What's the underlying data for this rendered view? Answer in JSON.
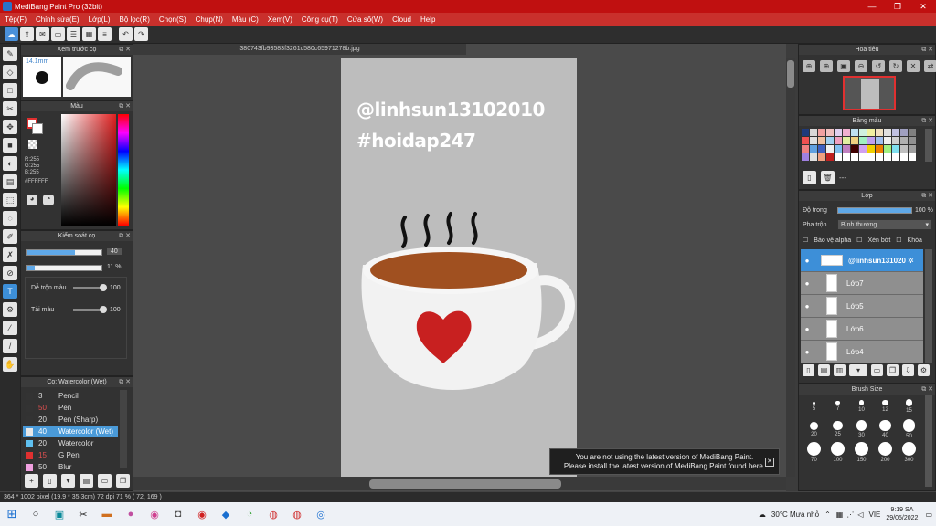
{
  "window": {
    "title": "MediBang Paint Pro (32bit)",
    "min": "—",
    "max": "❐",
    "close": "✕"
  },
  "menu": [
    "Tệp(F)",
    "Chỉnh sửa(E)",
    "Lớp(L)",
    "Bộ lọc(R)",
    "Chọn(S)",
    "Chụp(N)",
    "Màu (C)",
    "Xem(V)",
    "Công cụ(T)",
    "Cửa sổ(W)",
    "Cloud",
    "Help"
  ],
  "document": {
    "tab": "380743fb93583f3261c580c65971278b.jpg"
  },
  "canvas": {
    "caption1": "@linhsun13102010",
    "caption2": "#hoidap247",
    "background": "#bdbdbd"
  },
  "notice": {
    "line1": "You are not using the latest version of MediBang Paint.",
    "line2": "Please install the latest version of MediBang Paint found here."
  },
  "preview": {
    "title": "Xem trước cọ",
    "size": "14.1mm"
  },
  "color": {
    "title": "Màu",
    "r": "R:255",
    "g": "G:255",
    "b": "B:255",
    "hex": "#FFFFFF"
  },
  "brushctl": {
    "title": "Kiểm soát cọ",
    "size_val": "40",
    "opacity_val": "11 %",
    "blend_label": "Dễ trộn màu",
    "blend_val": "100",
    "paint_label": "Tải màu",
    "paint_val": "100",
    "size_fill": 0.65,
    "opacity_fill": 0.11
  },
  "brushlist": {
    "title": "Cọ: Watercolor (Wet)",
    "items": [
      {
        "num": "3",
        "name": "Pencil",
        "color": "#333333",
        "numcolor": "#dddddd"
      },
      {
        "num": "50",
        "name": "Pen",
        "color": "#333333",
        "numcolor": "#e05050"
      },
      {
        "num": "20",
        "name": "Pen (Sharp)",
        "color": "#333333",
        "numcolor": "#dddddd"
      },
      {
        "num": "40",
        "name": "Watercolor (Wet)",
        "color": "#e8e8e8",
        "numcolor": "#e05050",
        "sel": true
      },
      {
        "num": "20",
        "name": "Watercolor",
        "color": "#5fc0f0",
        "numcolor": "#dddddd"
      },
      {
        "num": "15",
        "name": "G Pen",
        "color": "#e03030",
        "numcolor": "#e05050"
      },
      {
        "num": "50",
        "name": "Blur",
        "color": "#f0a0e0",
        "numcolor": "#dddddd"
      }
    ]
  },
  "navigator": {
    "title": "Hoa tiêu"
  },
  "palette": {
    "title": "Bảng màu",
    "dots": "---",
    "colors": [
      "#1f3a7a",
      "#d8d8d8",
      "#f0a0a0",
      "#f0c0c0",
      "#e0d0f0",
      "#f0b0d0",
      "#c0e0f0",
      "#d0f0e0",
      "#f0f0a0",
      "#f0e0c0",
      "#e0e0e0",
      "#c0c0e0",
      "#a0a0c0",
      "#808080",
      "#f05050",
      "#e0e0e0",
      "#f0c0a0",
      "#a0d0f0",
      "#f0a0c0",
      "#e0f0a0",
      "#f0d080",
      "#a0f0c0",
      "#c0a0f0",
      "#a0c0f0",
      "#f0f0f0",
      "#d0d0d0",
      "#b0b0b0",
      "#909090",
      "#f08080",
      "#60a0e0",
      "#4060c0",
      "#f0f0f0",
      "#80c0f0",
      "#c080c0",
      "#400000",
      "#d0a0f0",
      "#f0d000",
      "#f08000",
      "#a0f080",
      "#80e0f0",
      "#c0c0c0",
      "#a0a0a0",
      "#a080e0",
      "#e0e0e0",
      "#f0a080",
      "#c02020",
      "#ffffff",
      "#ffffff",
      "#ffffff",
      "#ffffff",
      "#ffffff",
      "#ffffff",
      "#ffffff",
      "#ffffff",
      "#ffffff",
      "#ffffff"
    ]
  },
  "layers": {
    "title": "Lớp",
    "opacity_label": "Độ trong",
    "opacity_val": "100 %",
    "blend_label": "Pha trộn",
    "blend_val": "Bình thường",
    "protect_alpha": "Bảo vệ alpha",
    "clipping": "Xén bớt",
    "lock": "Khóa",
    "items": [
      {
        "name": "@linhsun131020",
        "sel": true
      },
      {
        "name": "Lớp7"
      },
      {
        "name": "Lớp5"
      },
      {
        "name": "Lớp6"
      },
      {
        "name": "Lớp4"
      }
    ]
  },
  "brushsize": {
    "title": "Brush Size",
    "sizes": [
      "5",
      "7",
      "10",
      "12",
      "15",
      "20",
      "25",
      "30",
      "40",
      "50",
      "70",
      "100",
      "150",
      "200",
      "300"
    ]
  },
  "status": {
    "text": "364 * 1002 pixel   (19.9 * 35.3cm)   72 dpi   71 %   ( 72, 169 )"
  },
  "taskbar": {
    "weather": "30°C  Mưa nhỏ",
    "lang": "VIE",
    "time": "9:19 SA",
    "date": "29/05/2022"
  }
}
